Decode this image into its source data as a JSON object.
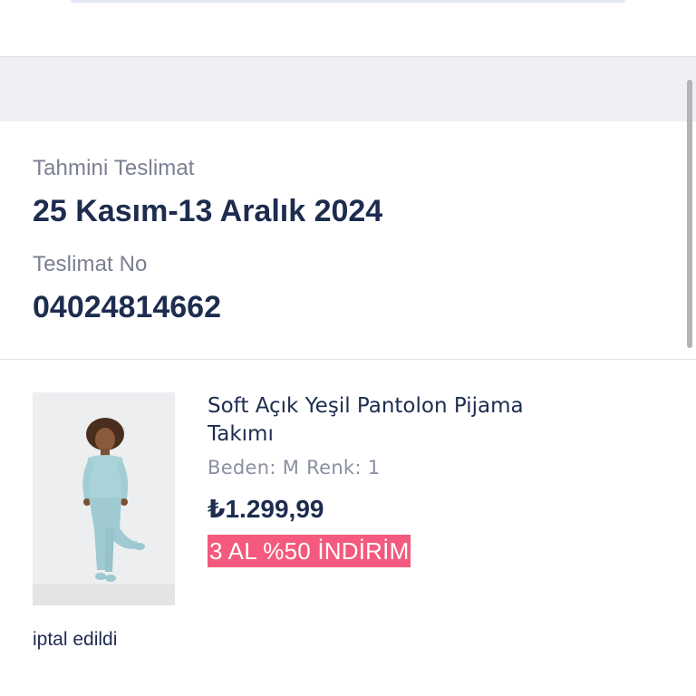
{
  "delivery": {
    "estimated_label": "Tahmini Teslimat",
    "estimated_value": "25 Kasım-13 Aralık 2024",
    "number_label": "Teslimat No",
    "number_value": "04024814662"
  },
  "product": {
    "image_icon": "product-photo",
    "title": "Soft Açık Yeşil Pantolon Pijama Takımı",
    "size_label": "Beden: M",
    "color_label": "Renk: 1",
    "price": "₺1.299,99",
    "promo": "3 AL %50 İNDİRİM",
    "status": "iptal edildi"
  },
  "colors": {
    "text_primary": "#1d2c4f",
    "text_muted": "#7b7f92",
    "promo_bg": "#f35a7d",
    "band_gray": "#eff0f4"
  }
}
